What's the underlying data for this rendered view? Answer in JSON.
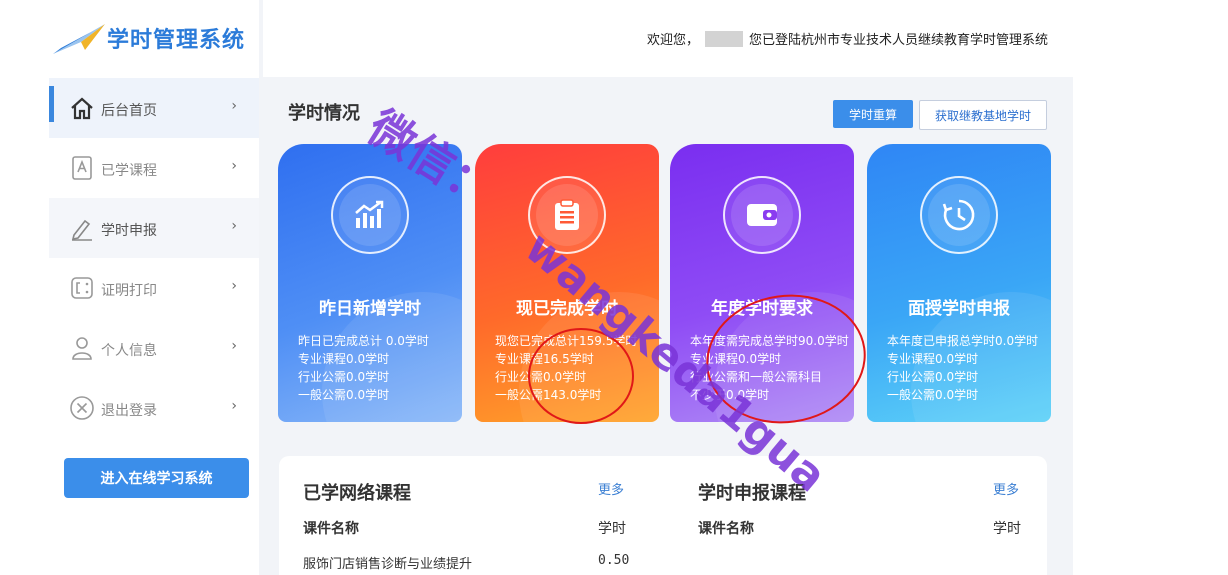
{
  "app": {
    "logo_text": "学时管理系统"
  },
  "header": {
    "welcome_prefix": "欢迎您，",
    "welcome_suffix": "您已登陆杭州市专业技术人员继续教育学时管理系统"
  },
  "sidebar": {
    "items": [
      {
        "label": "后台首页",
        "icon": "home-icon"
      },
      {
        "label": "已学课程",
        "icon": "book-icon"
      },
      {
        "label": "学时申报",
        "icon": "pen-icon"
      },
      {
        "label": "证明打印",
        "icon": "print-icon"
      },
      {
        "label": "个人信息",
        "icon": "user-icon"
      },
      {
        "label": "退出登录",
        "icon": "close-circle-icon"
      }
    ],
    "chevron": "›",
    "enter_button": "进入在线学习系统"
  },
  "main": {
    "section_title": "学时情况",
    "btn_recalc": "学时重算",
    "btn_fetch": "获取继教基地学时",
    "cards": [
      {
        "title": "昨日新增学时",
        "icon": "chart-growth-icon",
        "lines": [
          "昨日已完成总计 0.0学时",
          "专业课程0.0学时",
          "行业公需0.0学时",
          "一般公需0.0学时"
        ]
      },
      {
        "title": "现已完成学时",
        "icon": "clipboard-icon",
        "lines": [
          "现您已完成总计159.5学时",
          "专业课程16.5学时",
          "行业公需0.0学时",
          "一般公需143.0学时"
        ]
      },
      {
        "title": "年度学时要求",
        "icon": "wallet-icon",
        "lines": [
          "本年度需完成总学时90.0学时",
          "专业课程0.0学时",
          "行业公需和一般公需科目",
          "不少于0.0学时"
        ]
      },
      {
        "title": "面授学时申报",
        "icon": "clock-icon",
        "lines": [
          "本年度已申报总学时0.0学时",
          "专业课程0.0学时",
          "行业公需0.0学时",
          "一般公需0.0学时"
        ]
      }
    ],
    "courses": {
      "title": "已学网络课程",
      "more": "更多",
      "col_name": "课件名称",
      "col_hours": "学时",
      "rows": [
        {
          "name": "服饰门店销售诊断与业绩提升",
          "hours": "0.50"
        }
      ]
    },
    "declare": {
      "title": "学时申报课程",
      "more": "更多",
      "col_name": "课件名称",
      "col_hours": "学时"
    }
  },
  "watermark": {
    "line1": "微信：",
    "line2": "wangkeda1gua"
  },
  "colors": {
    "accent": "#3b8eea",
    "card1": "#3a7ef0",
    "card2": "#ff5a36",
    "card3": "#8a3cf0",
    "card4": "#2f9df5",
    "annotation": "#e01818"
  }
}
